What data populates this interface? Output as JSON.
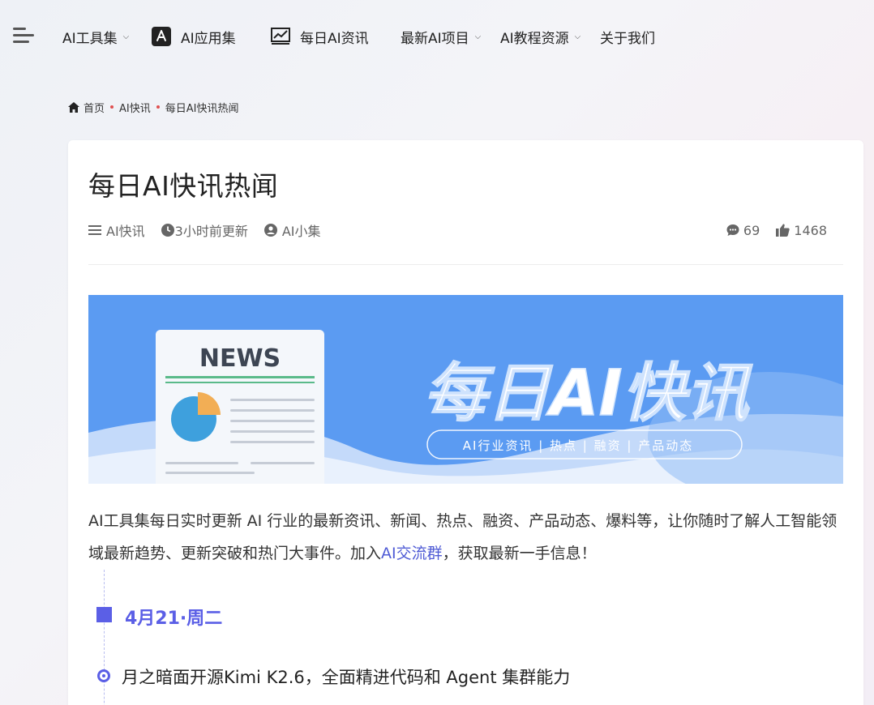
{
  "nav": {
    "items": [
      {
        "label": "AI工具集",
        "has_dropdown": true,
        "icon": null
      },
      {
        "label": "AI应用集",
        "has_dropdown": false,
        "icon": "app-store-icon"
      },
      {
        "label": "每日AI资讯",
        "has_dropdown": false,
        "icon": "trend-chart-icon"
      },
      {
        "label": "最新AI项目",
        "has_dropdown": true,
        "icon": null
      },
      {
        "label": "AI教程资源",
        "has_dropdown": true,
        "icon": null
      },
      {
        "label": "关于我们",
        "has_dropdown": false,
        "icon": null
      }
    ],
    "dropdown_glyph": "⌄"
  },
  "breadcrumb": {
    "home": "首页",
    "category": "AI快讯",
    "current": "每日AI快讯热闻"
  },
  "article": {
    "title": "每日AI快讯热闻",
    "meta": {
      "category": "AI快讯",
      "updated": "3小时前更新",
      "author": "AI小集",
      "comments": "69",
      "likes": "1468"
    },
    "banner": {
      "news_label": "NEWS",
      "headline": "每日AI快讯",
      "tagline": "AI行业资讯 | 热点 | 融资 | 产品动态",
      "bg_color": "#5b9bf2"
    },
    "intro_text": "AI工具集每日实时更新 AI 行业的最新资讯、新闻、热点、融资、产品动态、爆料等，让你随时了解人工智能领域最新趋势、更新突破和热门大事件。加入",
    "intro_link": "AI交流群",
    "intro_tail": "，获取最新一手信息！",
    "date_label": "4月21·周二",
    "first_news": "月之暗面开源Kimi K2.6，全面精进代码和 Agent 集群能力"
  },
  "colors": {
    "accent": "#5b5fe6",
    "link": "#4f5bd5",
    "breadcrumb_sep": "#e05050"
  }
}
